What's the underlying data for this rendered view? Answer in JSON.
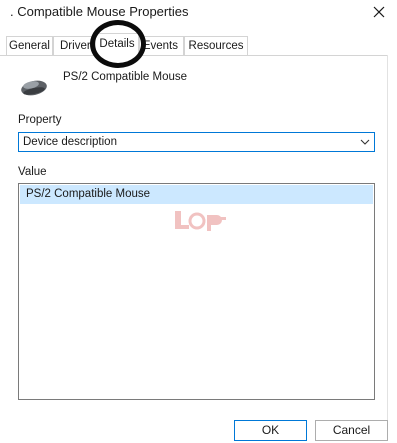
{
  "window": {
    "title": ". Compatible Mouse Properties",
    "close_icon": "close-icon"
  },
  "tabs": [
    {
      "label": "General",
      "active": false
    },
    {
      "label": "Driver",
      "active": false
    },
    {
      "label": "Details",
      "active": true
    },
    {
      "label": "Events",
      "active": false
    },
    {
      "label": "Resources",
      "active": false
    }
  ],
  "device": {
    "icon": "mouse-icon",
    "name": "PS/2 Compatible Mouse"
  },
  "property": {
    "label": "Property",
    "selected": "Device description",
    "chevron_icon": "chevron-down-icon"
  },
  "value": {
    "label": "Value",
    "items": [
      "PS/2 Compatible Mouse"
    ]
  },
  "buttons": {
    "ok": "OK",
    "cancel": "Cancel"
  },
  "colors": {
    "accent": "#0078d7",
    "selection": "#cce8ff",
    "annotation": "#0b0b0b"
  }
}
